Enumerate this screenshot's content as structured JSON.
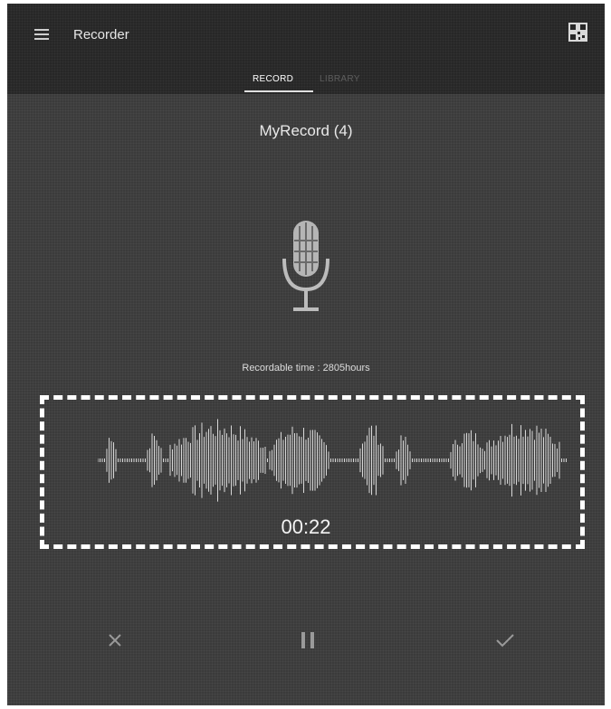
{
  "header": {
    "app_title": "Recorder"
  },
  "tabs": [
    {
      "label": "RECORD",
      "active": true
    },
    {
      "label": "LIBRARY",
      "active": false
    }
  ],
  "recording": {
    "name": "MyRecord (4)",
    "recordable_time": "Recordable time : 2805hours",
    "elapsed": "00:22"
  },
  "controls": {
    "cancel_icon": "close-icon",
    "pause_icon": "pause-icon",
    "save_icon": "check-icon"
  }
}
